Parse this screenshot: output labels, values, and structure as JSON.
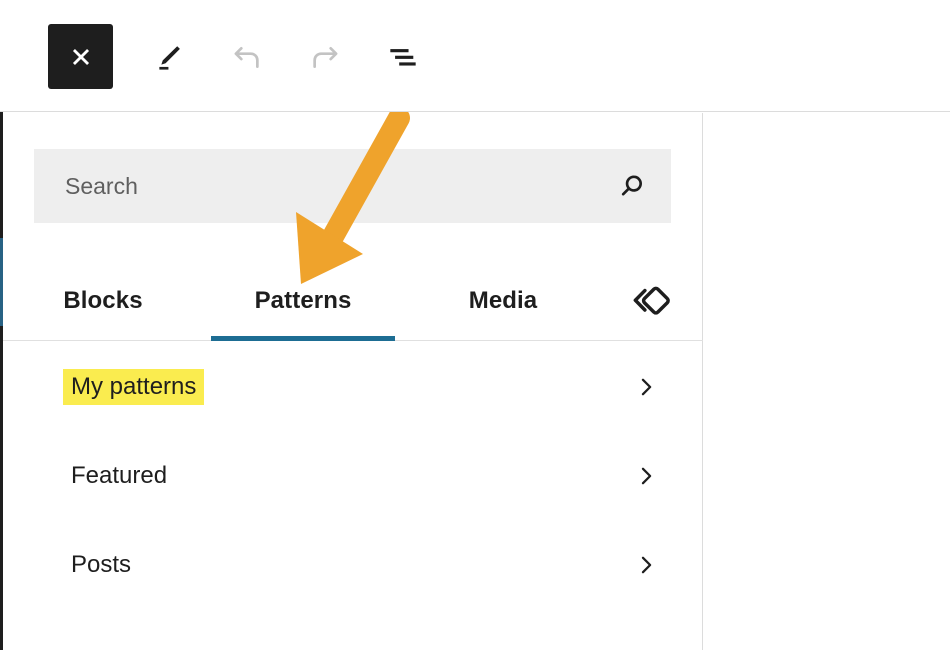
{
  "toolbar": {
    "close_label": "Close",
    "edit_label": "Edit",
    "undo_label": "Undo",
    "redo_label": "Redo",
    "list_view_label": "Document Overview",
    "icons": {
      "close": "close-x-icon",
      "edit": "pencil-icon",
      "undo": "undo-arrow-icon",
      "redo": "redo-arrow-icon",
      "list_view": "list-view-icon"
    },
    "colors": {
      "close_button_bg": "#1e1e1e",
      "disabled_icon": "#c8c8c8",
      "icon": "#1e1e1e"
    }
  },
  "inserter": {
    "search": {
      "placeholder": "Search",
      "value": "",
      "icon": "search-magnifier-icon",
      "background": "#eeeeee"
    },
    "tabs": [
      {
        "label": "Blocks",
        "active": false
      },
      {
        "label": "Patterns",
        "active": true
      },
      {
        "label": "Media",
        "active": false
      }
    ],
    "tabs_trailing_icon": "reusable-block-diamond-icon",
    "active_tab_underline_color": "#1d6d93",
    "categories": [
      {
        "label": "My patterns",
        "highlighted": true,
        "chevron": "chevron-right-icon"
      },
      {
        "label": "Featured",
        "highlighted": false,
        "chevron": "chevron-right-icon"
      },
      {
        "label": "Posts",
        "highlighted": false,
        "chevron": "chevron-right-icon"
      }
    ],
    "highlight_color": "#faec4f"
  },
  "annotation": {
    "arrow": {
      "name": "orange-pointer-arrow",
      "color": "#efa32c",
      "points_to": "Patterns",
      "direction": "down-left"
    }
  },
  "canvas": {
    "background": "#ffffff"
  }
}
